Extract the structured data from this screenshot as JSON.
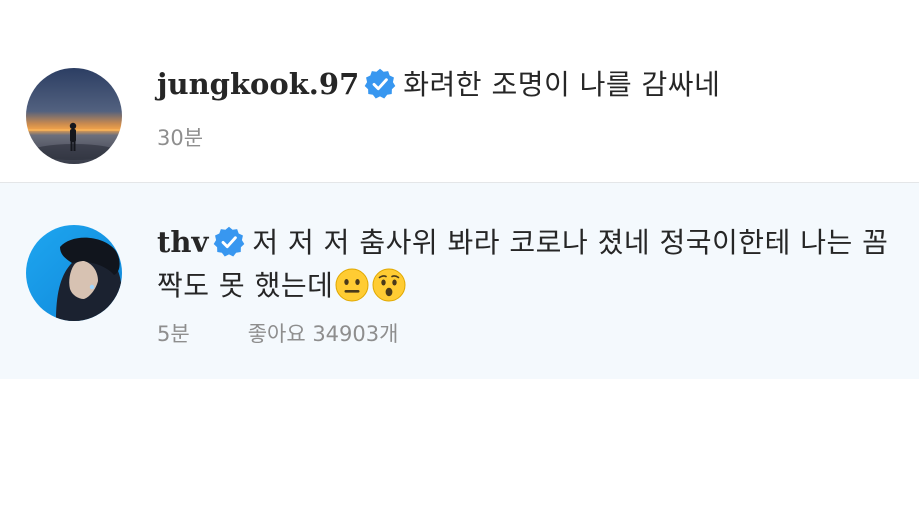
{
  "comments": [
    {
      "username": "jungkook.97",
      "verified": true,
      "avatar_icon": "sunset-silhouette-avatar",
      "text": "화려한 조명이 나를 감싸네",
      "time": "30분"
    },
    {
      "username": "thv",
      "verified": true,
      "avatar_icon": "portrait-blue-avatar",
      "text": "저 저 저 춤사위 봐라 코로나 졌네 정국이한테 나는 꼼짝도 못 했는데",
      "emojis": [
        "neutral-face-emoji",
        "hushed-face-emoji"
      ],
      "time": "5분",
      "likes": "좋아요 34903개"
    }
  ],
  "colors": {
    "verified_badge": "#3897f0",
    "meta_text": "#8e8e8e",
    "highlight_background": "#f4f9fd",
    "divider": "#e4e6e8"
  }
}
